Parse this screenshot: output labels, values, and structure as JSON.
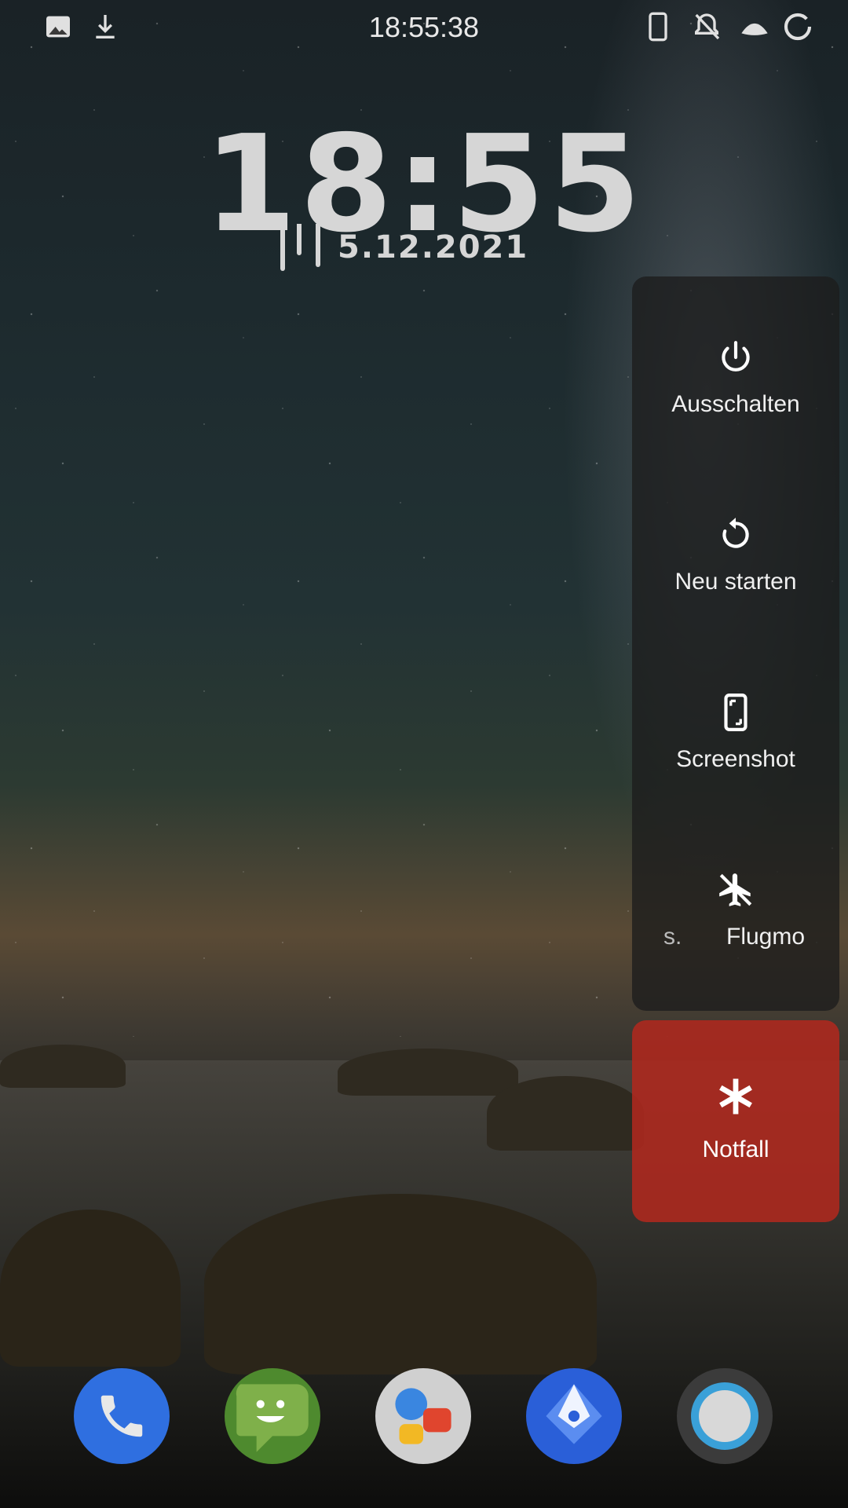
{
  "status_bar": {
    "time": "18:55:38",
    "left_icons": [
      "image-icon",
      "download-icon"
    ],
    "right_icons": [
      "phone-device-icon",
      "notifications-off-icon",
      "signal-icon",
      "battery-icon"
    ]
  },
  "lockscreen_clock": {
    "time": "18:55",
    "date": "5.12.2021"
  },
  "power_menu": {
    "items": [
      {
        "label": "Ausschalten",
        "icon": "power-icon"
      },
      {
        "label": "Neu starten",
        "icon": "restart-icon"
      },
      {
        "label": "Screenshot",
        "icon": "screenshot-icon"
      },
      {
        "label": "Flugmo",
        "icon": "airplane-icon",
        "partial_prefix": "s."
      }
    ],
    "emergency": {
      "label": "Notfall",
      "icon": "asterisk-icon",
      "color": "#b02a1e"
    }
  },
  "dock": {
    "apps": [
      {
        "name": "phone-app",
        "color": "#2f6fe0"
      },
      {
        "name": "messages-app",
        "color": "#4e8a2e"
      },
      {
        "name": "contacts-chat-app",
        "color": "#d0d0d0"
      },
      {
        "name": "maps-app",
        "color": "#2a5fd8"
      },
      {
        "name": "camera-app",
        "color": "#3b3b3b"
      }
    ]
  }
}
